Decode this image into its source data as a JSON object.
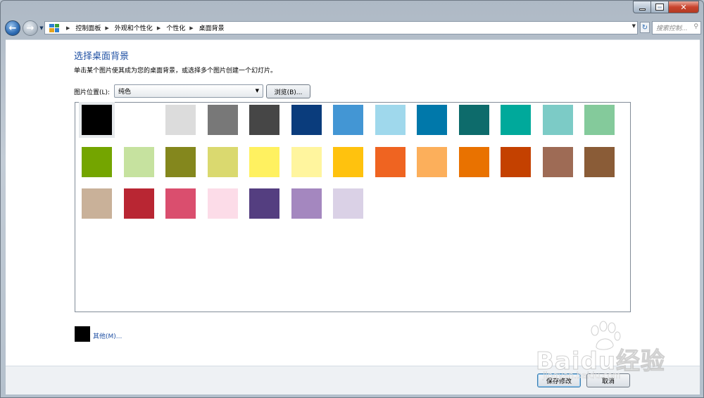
{
  "nav": {
    "breadcrumbs": [
      "控制面板",
      "外观和个性化",
      "个性化",
      "桌面背景"
    ],
    "search_placeholder": "搜索控制..."
  },
  "main": {
    "title": "选择桌面背景",
    "subtitle": "单击某个图片使其成为您的桌面背景，或选择多个图片创建一个幻灯片。",
    "location_label": "图片位置(L):",
    "location_value": "纯色",
    "browse_label": "浏览(B)...",
    "other_label": "其他(M)...",
    "selected_color": "#000000",
    "swatches": [
      [
        "#000000",
        "#ffffff",
        "#dcdcdc",
        "#787878",
        "#464646",
        "#0a3c7c",
        "#4396d4",
        "#9fd8ec",
        "#0078aa",
        "#0d6b6b",
        "#00a99b",
        "#7ccbc6",
        "#84ca9b"
      ],
      [
        "#74a500",
        "#c6e29f",
        "#84871d",
        "#dad96f",
        "#fff160",
        "#fff59e",
        "#ffc20e",
        "#ef6421",
        "#fcaf5b",
        "#e97200",
        "#c44100",
        "#9e6b55",
        "#8a5c37"
      ],
      [
        "#c9b199",
        "#b92633",
        "#da4e6e",
        "#fcdce8",
        "#543e80",
        "#a487bf",
        "#dad1e6"
      ]
    ]
  },
  "footer": {
    "save_label": "保存修改",
    "cancel_label": "取消"
  },
  "watermark": {
    "text": "Baidu经验",
    "url": "jingyan.baidu.com"
  }
}
